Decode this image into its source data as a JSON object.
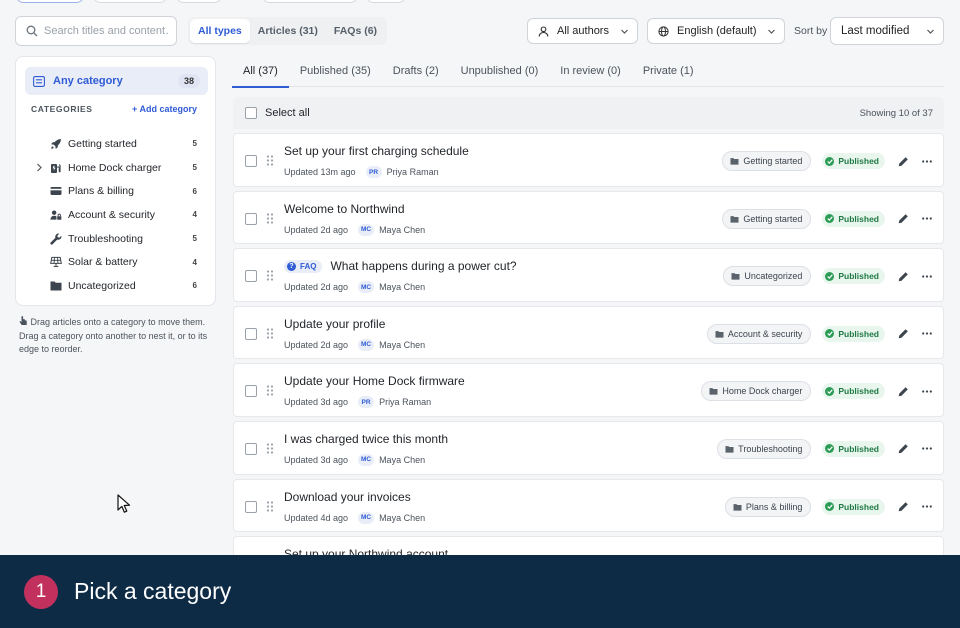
{
  "toolbar": {
    "search_placeholder": "Search titles and content…",
    "types": [
      {
        "label": "All types",
        "active": true
      },
      {
        "label": "Articles (31)",
        "active": false
      },
      {
        "label": "FAQs (6)",
        "active": false
      }
    ],
    "authors_dropdown": "All authors",
    "language_dropdown": "English (default)",
    "sort_label": "Sort by",
    "sort_value": "Last modified"
  },
  "sidebar": {
    "any_category": {
      "label": "Any category",
      "count": "38"
    },
    "categories_heading": "CATEGORIES",
    "add_category": "Add category",
    "categories": [
      {
        "label": "Getting started",
        "count": "5",
        "icon": "rocket-icon",
        "expandable": false
      },
      {
        "label": "Home Dock charger",
        "count": "5",
        "icon": "charger-icon",
        "expandable": true
      },
      {
        "label": "Plans & billing",
        "count": "6",
        "icon": "credit-card-icon",
        "expandable": false
      },
      {
        "label": "Account & security",
        "count": "4",
        "icon": "user-lock-icon",
        "expandable": false
      },
      {
        "label": "Troubleshooting",
        "count": "5",
        "icon": "wrench-icon",
        "expandable": false
      },
      {
        "label": "Solar & battery",
        "count": "4",
        "icon": "solar-panel-icon",
        "expandable": false
      },
      {
        "label": "Uncategorized",
        "count": "6",
        "icon": "folder-icon",
        "expandable": false
      }
    ],
    "hint": "Drag articles onto a category to move them. Drag a category onto another to nest it, or to its edge to reorder."
  },
  "tabs": [
    {
      "label": "All (37)",
      "active": true
    },
    {
      "label": "Published (35)",
      "active": false
    },
    {
      "label": "Drafts (2)",
      "active": false
    },
    {
      "label": "Unpublished (0)",
      "active": false
    },
    {
      "label": "In review (0)",
      "active": false
    },
    {
      "label": "Private (1)",
      "active": false
    }
  ],
  "list": {
    "select_all": "Select all",
    "showing": "Showing 10 of 37",
    "faq_badge": "FAQ",
    "rows": [
      {
        "title": "Set up your first charging schedule",
        "updated": "Updated 13m ago",
        "initials": "PR",
        "author": "Priya Raman",
        "category": "Getting started",
        "status": "Published",
        "faq": false
      },
      {
        "title": "Welcome to Northwind",
        "updated": "Updated 2d ago",
        "initials": "MC",
        "author": "Maya Chen",
        "category": "Getting started",
        "status": "Published",
        "faq": false
      },
      {
        "title": "What happens during a power cut?",
        "updated": "Updated 2d ago",
        "initials": "MC",
        "author": "Maya Chen",
        "category": "Uncategorized",
        "status": "Published",
        "faq": true
      },
      {
        "title": "Update your profile",
        "updated": "Updated 2d ago",
        "initials": "MC",
        "author": "Maya Chen",
        "category": "Account & security",
        "status": "Published",
        "faq": false
      },
      {
        "title": "Update your Home Dock firmware",
        "updated": "Updated 3d ago",
        "initials": "PR",
        "author": "Priya Raman",
        "category": "Home Dock charger",
        "status": "Published",
        "faq": false
      },
      {
        "title": "I was charged twice this month",
        "updated": "Updated 3d ago",
        "initials": "MC",
        "author": "Maya Chen",
        "category": "Troubleshooting",
        "status": "Published",
        "faq": false
      },
      {
        "title": "Download your invoices",
        "updated": "Updated 4d ago",
        "initials": "MC",
        "author": "Maya Chen",
        "category": "Plans & billing",
        "status": "Published",
        "faq": false
      },
      {
        "title": "Set up your Northwind account",
        "updated": "",
        "initials": "",
        "author": "",
        "category": "",
        "status": "",
        "faq": false
      }
    ]
  },
  "footer": {
    "step": "1",
    "caption": "Pick a category"
  },
  "colors": {
    "accent": "#2f5bd4",
    "footer_bg": "#0e2b46",
    "step_badge": "#c2315e",
    "published": "#2c9b56"
  }
}
